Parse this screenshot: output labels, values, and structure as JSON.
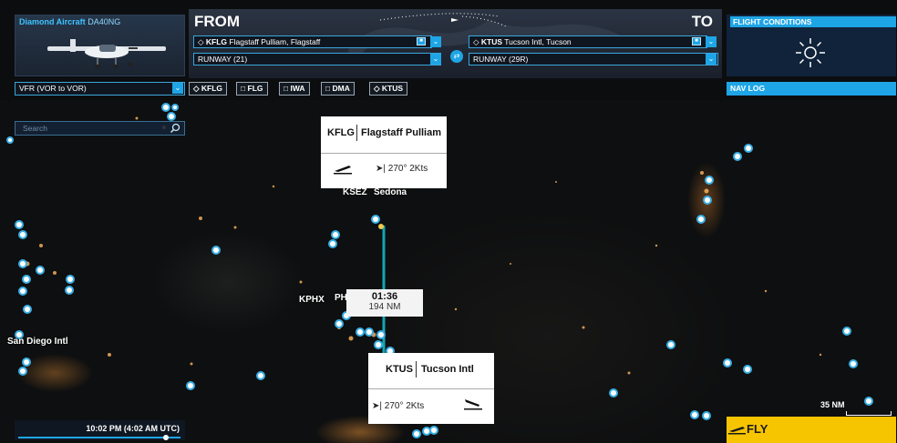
{
  "aircraft": {
    "brand": "Diamond Aircraft",
    "model": "DA40NG"
  },
  "route": {
    "from_label": "FROM",
    "to_label": "TO",
    "departure": {
      "code": "KFLG",
      "name": "Flagstaff Pulliam, Flagstaff",
      "runway": "RUNWAY (21)"
    },
    "arrival": {
      "code": "KTUS",
      "name": "Tucson Intl, Tucson",
      "runway": "RUNWAY (29R)"
    }
  },
  "flight_conditions": {
    "title": "FLIGHT CONDITIONS",
    "weather_icon": "sun-icon"
  },
  "flight_plan": {
    "type": "VFR (VOR to VOR)",
    "waypoints": [
      "KFLG",
      "FLG",
      "IWA",
      "DMA",
      "KTUS"
    ]
  },
  "nav_log": {
    "title": "NAV LOG"
  },
  "search": {
    "placeholder": "Search"
  },
  "map": {
    "departure_card": {
      "code": "KFLG",
      "name": "Flagstaff Pulliam",
      "wind": "270° 2Kts"
    },
    "arrival_card": {
      "code": "KTUS",
      "name": "Tucson Intl",
      "wind": "270° 2Kts"
    },
    "route_time": "01:36",
    "route_distance": "194 NM",
    "labels": {
      "ksez": "KSEZ",
      "sedona": "Sedona",
      "kphx": "KPHX",
      "kphx_partial": "PH",
      "san_diego": "San Diego Intl"
    },
    "scale": "35 NM"
  },
  "time": {
    "display": "10:02 PM (4:02 AM UTC)"
  },
  "fly_button": {
    "label": "FLY"
  },
  "colors": {
    "accent": "#1ea5e6",
    "fly": "#f7c400",
    "route_line": "#13a6b2"
  }
}
